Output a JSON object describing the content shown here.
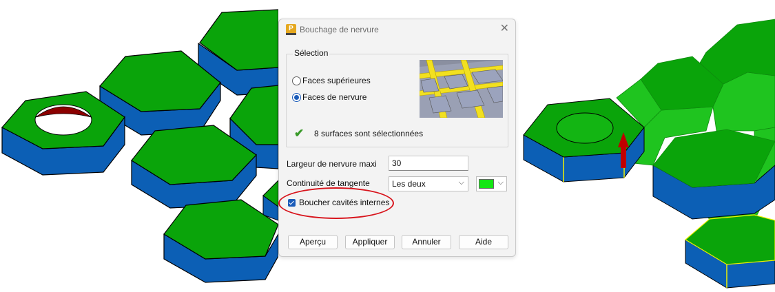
{
  "dialog": {
    "title": "Bouchage de nervure",
    "close_glyph": "✕",
    "app_icon_letter": "P",
    "selection_group": {
      "label": "Sélection",
      "options": [
        {
          "label": "Faces supérieures",
          "checked": false
        },
        {
          "label": "Faces de nervure",
          "checked": true
        }
      ],
      "status_text": "8 surfaces sont sélectionnées",
      "status_icon": "green-checkmark-icon"
    },
    "max_rib_width": {
      "label": "Largeur de nervure maxi",
      "value": "30"
    },
    "tangent_continuity": {
      "label": "Continuité de tangente",
      "value": "Les deux"
    },
    "color": "#14e614",
    "fill_internal_cavities": {
      "label": "Boucher cavités internes",
      "checked": true
    },
    "buttons": {
      "preview": "Aperçu",
      "apply": "Appliquer",
      "cancel": "Annuler",
      "help": "Aide"
    }
  },
  "colors": {
    "top_face": "#0aa40a",
    "side_face": "#0c5fb5",
    "cap_face": "#1fc41f",
    "hole_inner": "#8b0000",
    "highlight_edge": "#f0f000",
    "annotation": "#d8141c",
    "arrow": "#c00000"
  }
}
